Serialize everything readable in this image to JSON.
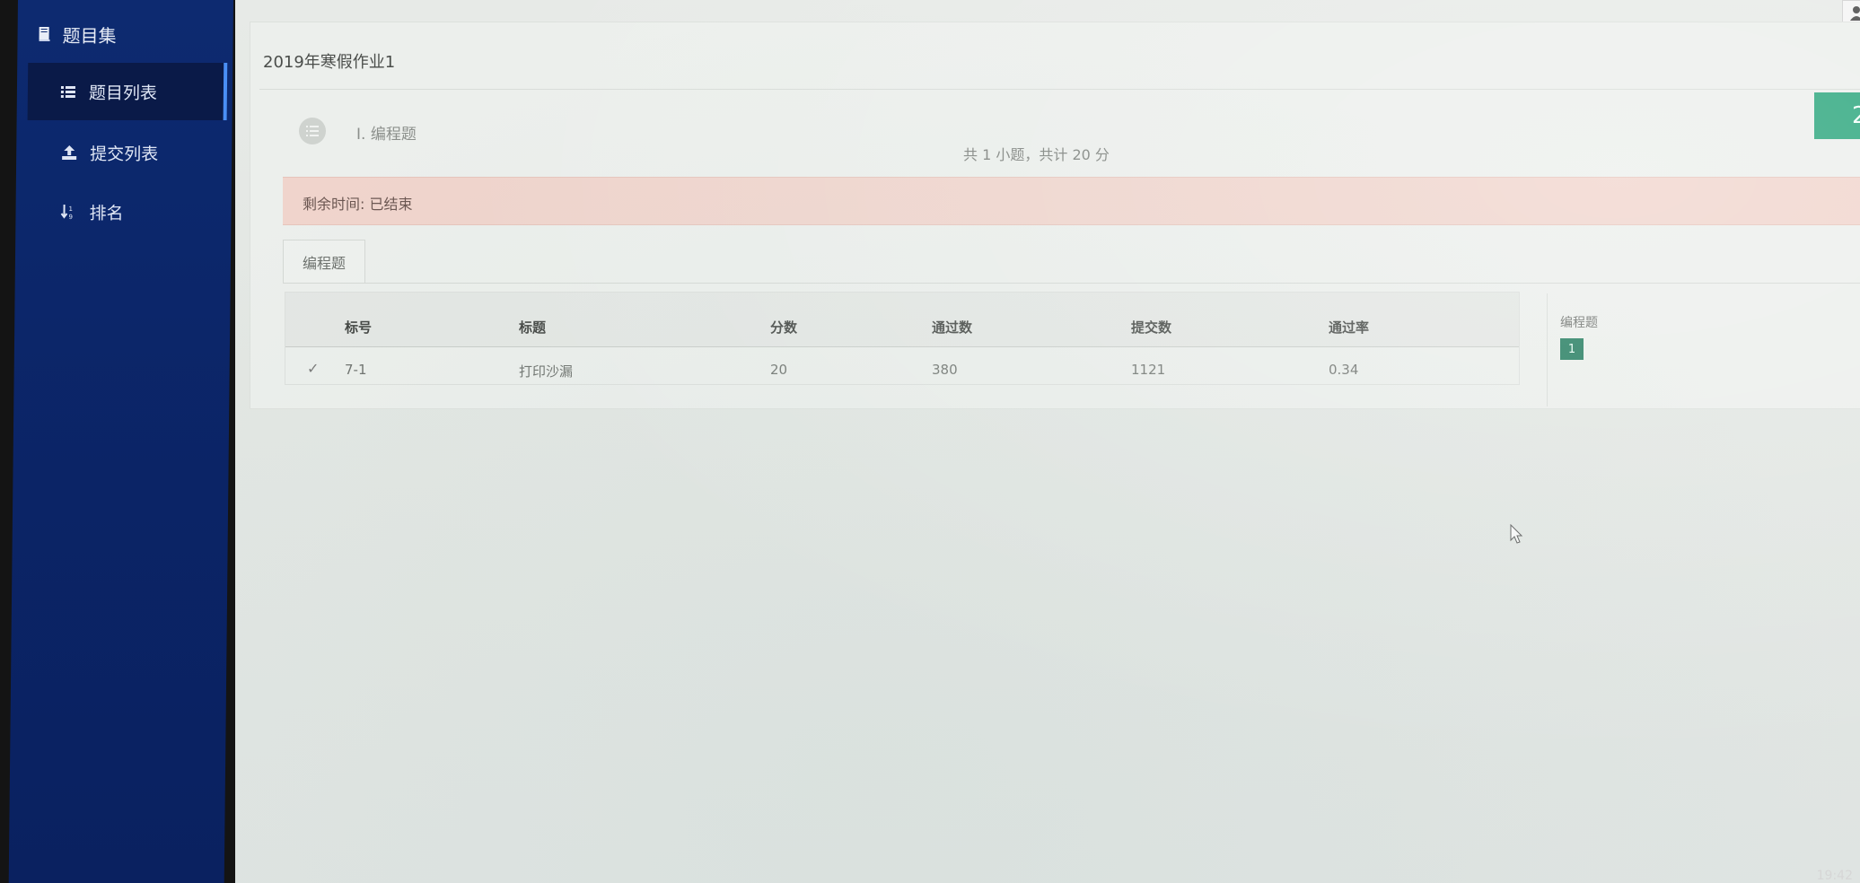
{
  "sidebar": {
    "header": "题目集",
    "items": [
      {
        "label": "题目列表",
        "active": true
      },
      {
        "label": "提交列表",
        "active": false
      },
      {
        "label": "排名",
        "active": false
      }
    ]
  },
  "page": {
    "title": "2019年寒假作业1",
    "section": {
      "label": "I. 编程题",
      "summary": "共 1 小题，共计 20 分",
      "score": "20"
    },
    "timer": "剩余时间: 已结束",
    "tab": "编程题",
    "table": {
      "columns": [
        "标号",
        "标题",
        "分数",
        "通过数",
        "提交数",
        "通过率"
      ],
      "rows": [
        {
          "status": "✓",
          "id": "7-1",
          "title": "打印沙漏",
          "score": "20",
          "passed": "380",
          "submitted": "1121",
          "rate": "0.34"
        }
      ]
    },
    "panel": {
      "label": "编程题",
      "chip": "1"
    }
  },
  "taskbar": {
    "clock": "19:42"
  },
  "colors": {
    "sidebar": "#0d2a70",
    "score_box": "#27a47a",
    "timer_bar": "#f0d4cc",
    "chip": "#1f7a5c"
  }
}
